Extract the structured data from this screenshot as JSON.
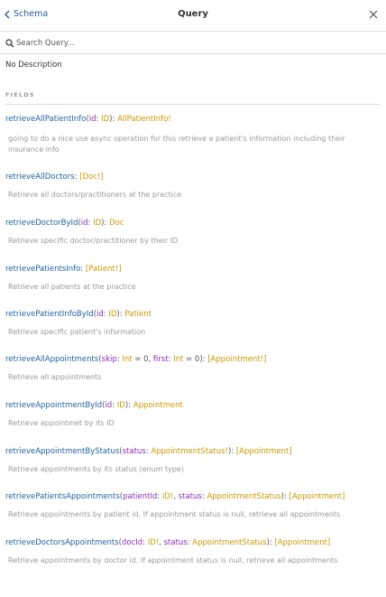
{
  "header": {
    "back_label": "Schema",
    "title": "Query"
  },
  "search": {
    "placeholder": "Search Query..."
  },
  "description": "No Description",
  "section_title": "FIELDS",
  "fields": [
    {
      "name": "retrieveAllPatientInfo",
      "args": [
        {
          "name": "id",
          "type": "ID"
        }
      ],
      "type": "AllPatientInfo!",
      "description": "going to do a nice use async operation for this retrieve a patient's information including their insurance info"
    },
    {
      "name": "retrieveAllDoctors",
      "args": [],
      "type": "[Doc!]",
      "description": "Retrieve all doctors/practitioners at the practice"
    },
    {
      "name": "retrieveDoctorById",
      "args": [
        {
          "name": "id",
          "type": "ID"
        }
      ],
      "type": "Doc",
      "description": "Retrieve specific doctor/practitioner by their ID"
    },
    {
      "name": "retrievePatientsInfo",
      "args": [],
      "type": "[Patient!]",
      "description": "Retrieve all patients at the practice"
    },
    {
      "name": "retrievePatientInfoById",
      "args": [
        {
          "name": "id",
          "type": "ID"
        }
      ],
      "type": "Patient",
      "description": "Retrieve specific patient's information"
    },
    {
      "name": "retrieveAllAppointments",
      "args": [
        {
          "name": "skip",
          "type": "Int",
          "default": "0"
        },
        {
          "name": "first",
          "type": "Int",
          "default": "0"
        }
      ],
      "type": "[Appointment!]",
      "description": "Retrieve all appointments"
    },
    {
      "name": "retrieveAppointmentById",
      "args": [
        {
          "name": "id",
          "type": "ID"
        }
      ],
      "type": "Appointment",
      "description": "Retrieve appointmet by its ID"
    },
    {
      "name": "retrieveAppointmentByStatus",
      "args": [
        {
          "name": "status",
          "type": "AppointmentStatus!"
        }
      ],
      "type": "[Appointment]",
      "description": "Retrieve appointments by its status (enum type)"
    },
    {
      "name": "retrievePatientsAppointments",
      "args": [
        {
          "name": "patientId",
          "type": "ID!"
        },
        {
          "name": "status",
          "type": "AppointmentStatus"
        }
      ],
      "type": "[Appointment]",
      "description": "Retrieve appointments by patient id. If appointment status is null, retrieve all appointments"
    },
    {
      "name": "retrieveDoctorsAppointments",
      "args": [
        {
          "name": "docId",
          "type": "ID!"
        },
        {
          "name": "status",
          "type": "AppointmentStatus"
        }
      ],
      "type": "[Appointment]",
      "description": "Retrieve appointments by doctor id. If appointment status is null, retrieve all appointments"
    }
  ]
}
